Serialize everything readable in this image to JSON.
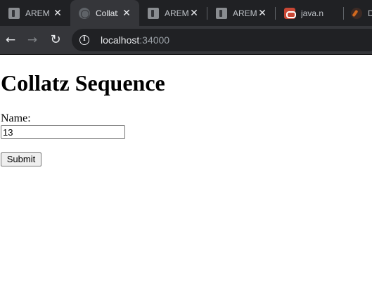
{
  "browser": {
    "tabs": [
      {
        "title": "AREM",
        "icon": "page-icon",
        "active": false
      },
      {
        "title": "Collatz",
        "icon": "globe-icon",
        "active": true
      },
      {
        "title": "AREM",
        "icon": "page-icon",
        "active": false
      },
      {
        "title": "AREM",
        "icon": "page-icon",
        "active": false
      },
      {
        "title": "java.n",
        "icon": "oracle-icon",
        "active": false
      },
      {
        "title": "D",
        "icon": "feather-icon",
        "active": false
      }
    ],
    "close_glyph": "✕",
    "nav": {
      "back": "←",
      "forward": "→",
      "reload": "↻"
    },
    "address": {
      "host": "localhost",
      "port": ":34000",
      "info_glyph": "i"
    }
  },
  "page": {
    "title": "Collatz Sequence",
    "form": {
      "label": "Name:",
      "input_value": "13",
      "submit_label": "Submit"
    }
  }
}
